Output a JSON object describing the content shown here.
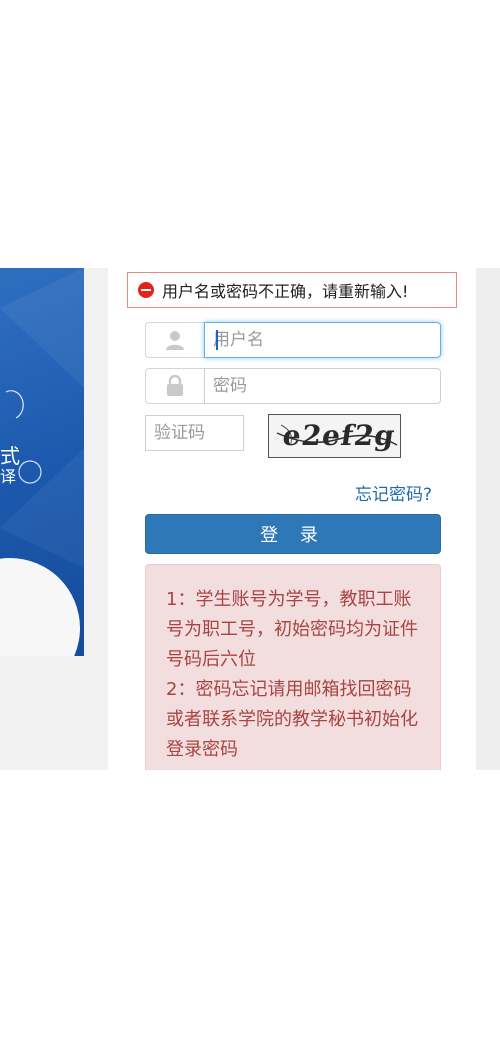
{
  "error": {
    "message": "用户名或密码不正确，请重新输入!"
  },
  "hero": {
    "line1": "式",
    "line2": "译"
  },
  "form": {
    "username_placeholder": "用户名",
    "password_placeholder": "密码",
    "captcha_placeholder": "验证码",
    "captcha_text": "e2ef2g",
    "forgot_label": "忘记密码?",
    "login_label": "登 录"
  },
  "notice": {
    "lines": [
      "1：学生账号为学号，教职工账号为职工号，初始密码均为证件号码后六位",
      "2：密码忘记请用邮箱找回密码或者联系学院的教学秘书初始化登录密码"
    ]
  },
  "icons": {
    "username": "user-icon",
    "password": "lock-icon",
    "error": "minus-circle-icon"
  },
  "colors": {
    "primary": "#2f78b8",
    "error": "#e2231a",
    "notice_bg": "#f2dede",
    "notice_text": "#a94442",
    "link": "#1f6aa8"
  }
}
